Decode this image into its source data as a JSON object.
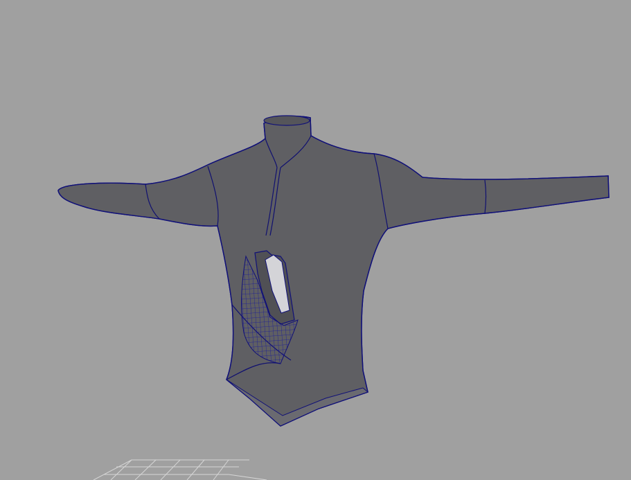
{
  "viewport": {
    "background_color": "#a0a0a0",
    "mesh_fill_color": "#5f5f63",
    "wireframe_color": "#18189a",
    "hole_color": "#d4d4d8",
    "grid_color": "#d6d6d6"
  }
}
